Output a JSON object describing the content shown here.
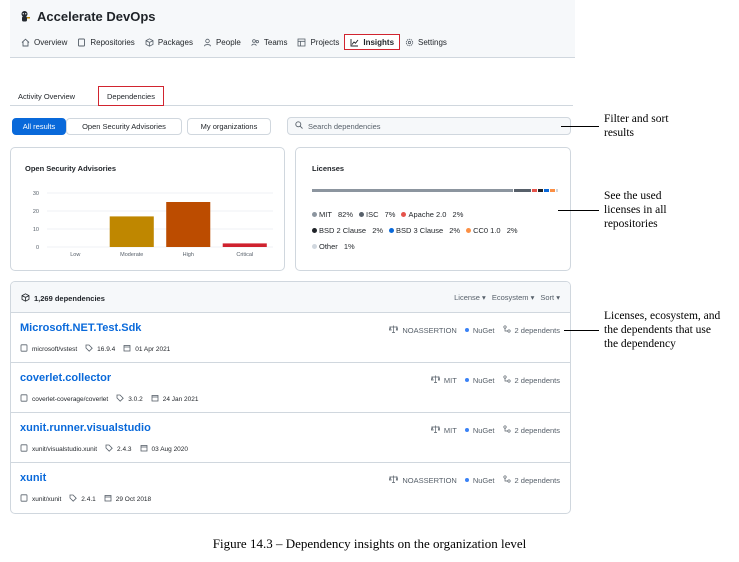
{
  "org": {
    "name": "Accelerate DevOps"
  },
  "nav": [
    {
      "label": "Overview",
      "icon": "home-icon"
    },
    {
      "label": "Repositories",
      "icon": "repo-icon"
    },
    {
      "label": "Packages",
      "icon": "package-icon"
    },
    {
      "label": "People",
      "icon": "person-icon"
    },
    {
      "label": "Teams",
      "icon": "people-icon"
    },
    {
      "label": "Projects",
      "icon": "table-icon"
    },
    {
      "label": "Insights",
      "icon": "graph-icon",
      "active": true
    },
    {
      "label": "Settings",
      "icon": "gear-icon"
    }
  ],
  "tabs": {
    "activity": "Activity Overview",
    "dependencies": "Dependencies"
  },
  "filters": {
    "all": "All results",
    "advisories": "Open Security Advisories",
    "my_orgs": "My organizations",
    "search_placeholder": "Search dependencies"
  },
  "advisories_card": {
    "title": "Open Security Advisories",
    "chart_data": {
      "type": "bar",
      "categories": [
        "Low",
        "Moderate",
        "High",
        "Critical"
      ],
      "values": [
        0,
        17,
        25,
        2
      ],
      "colors": [
        "#bf8700",
        "#bf8700",
        "#bc4c00",
        "#cf222e"
      ],
      "y_ticks": [
        "30",
        "20",
        "10",
        "0"
      ],
      "ylim": [
        0,
        30
      ]
    }
  },
  "licenses_card": {
    "title": "Licenses",
    "items": [
      {
        "name": "MIT",
        "pct": "82%",
        "value": 82,
        "color": "#8c959f"
      },
      {
        "name": "ISC",
        "pct": "7%",
        "value": 7,
        "color": "#57606a"
      },
      {
        "name": "Apache 2.0",
        "pct": "2%",
        "value": 2,
        "color": "#e5534b"
      },
      {
        "name": "BSD 2 Clause",
        "pct": "2%",
        "value": 2,
        "color": "#1f2328"
      },
      {
        "name": "BSD 3 Clause",
        "pct": "2%",
        "value": 2,
        "color": "#0969da"
      },
      {
        "name": "CC0 1.0",
        "pct": "2%",
        "value": 2,
        "color": "#fb8f44"
      },
      {
        "name": "Other",
        "pct": "1%",
        "value": 1,
        "color": "#d0d7de"
      }
    ]
  },
  "deps": {
    "count": "1,269 dependencies",
    "sorts": [
      "License",
      "Ecosystem",
      "Sort"
    ],
    "rows": [
      {
        "name": "Microsoft.NET.Test.Sdk",
        "repo": "microsoft/vstest",
        "version": "16.9.4",
        "date": "01 Apr 2021",
        "license": "NOASSERTION",
        "ecosystem": "NuGet",
        "dependents": "2 dependents"
      },
      {
        "name": "coverlet.collector",
        "repo": "coverlet-coverage/coverlet",
        "version": "3.0.2",
        "date": "24 Jan 2021",
        "license": "MIT",
        "ecosystem": "NuGet",
        "dependents": "2 dependents"
      },
      {
        "name": "xunit.runner.visualstudio",
        "repo": "xunit/visualstudio.xunit",
        "version": "2.4.3",
        "date": "03 Aug 2020",
        "license": "MIT",
        "ecosystem": "NuGet",
        "dependents": "2 dependents"
      },
      {
        "name": "xunit",
        "repo": "xunit/xunit",
        "version": "2.4.1",
        "date": "29 Oct 2018",
        "license": "NOASSERTION",
        "ecosystem": "NuGet",
        "dependents": "2 dependents"
      }
    ]
  },
  "annotations": {
    "filter": [
      "Filter and sort",
      "results"
    ],
    "licenses": [
      "See the used",
      "licenses in all",
      "repositories"
    ],
    "deps": [
      "Licenses, ecosystem, and",
      "the dependents that use",
      "the dependency"
    ]
  },
  "caption": "Figure 14.3 – Dependency insights on the organization level"
}
